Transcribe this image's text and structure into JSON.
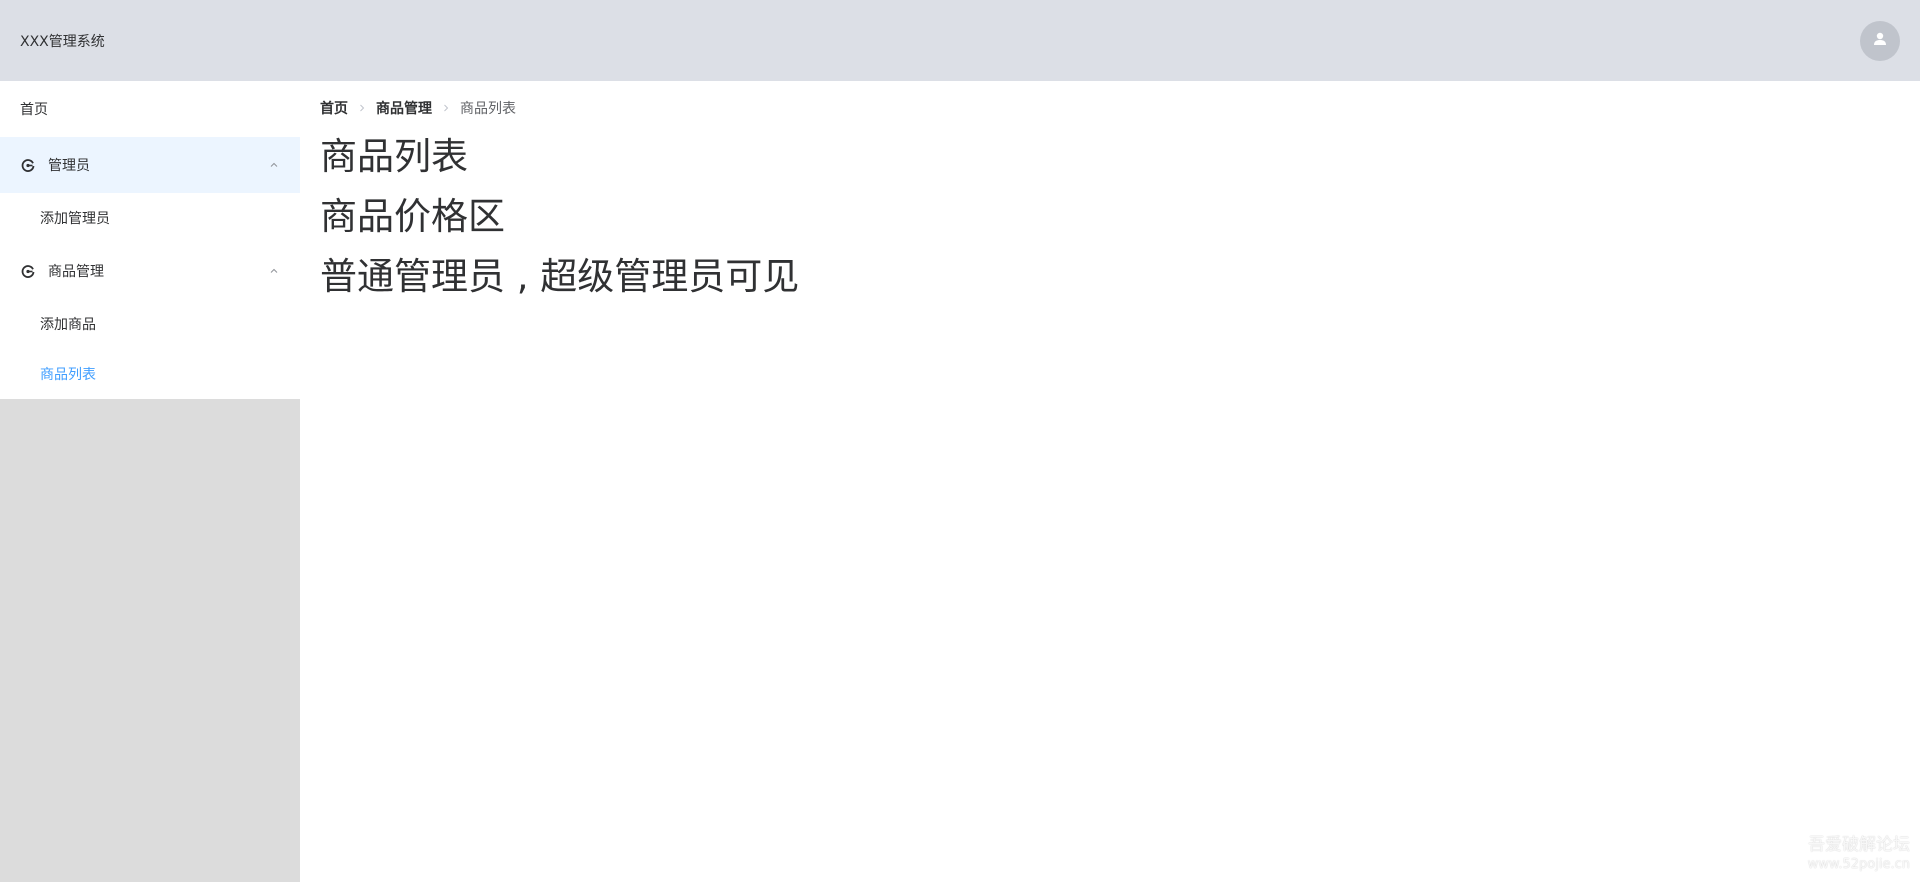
{
  "header": {
    "title": "XXX管理系统",
    "avatar_icon": "user-icon"
  },
  "sidebar": {
    "home_label": "首页",
    "groups": [
      {
        "label": "管理员",
        "icon": "dashboard-icon",
        "expanded": true,
        "items": [
          {
            "label": "添加管理员"
          }
        ]
      },
      {
        "label": "商品管理",
        "icon": "dashboard-icon",
        "expanded": true,
        "items": [
          {
            "label": "添加商品"
          },
          {
            "label": "商品列表",
            "selected": true
          }
        ]
      }
    ]
  },
  "breadcrumb": [
    "首页",
    "商品管理",
    "商品列表"
  ],
  "main": {
    "lines": [
      "商品列表",
      "商品价格区",
      "普通管理员 , 超级管理员可见"
    ]
  },
  "watermark": {
    "line1": "吾爱破解论坛",
    "line2": "www.52pojie.cn"
  },
  "colors": {
    "header_bg": "#dcdfe6",
    "sidebar_bg": "#dcdcdc",
    "accent": "#409eff",
    "active_bg": "#ecf5ff"
  }
}
